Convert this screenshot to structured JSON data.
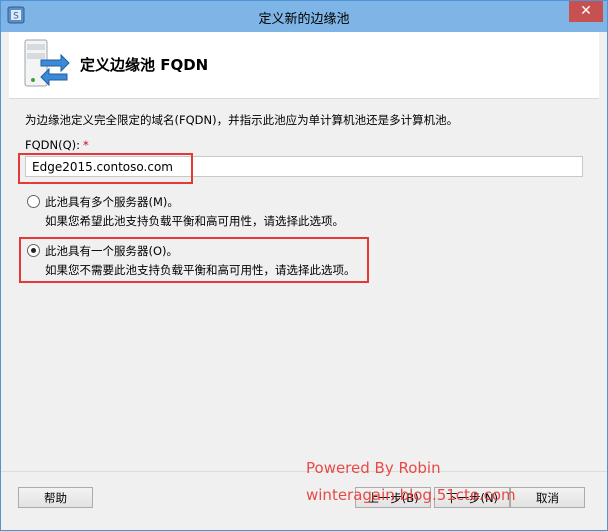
{
  "window": {
    "title": "定义新的边缘池",
    "close_glyph": "✕"
  },
  "header": {
    "title": "定义边缘池 FQDN"
  },
  "form": {
    "description": "为边缘池定义完全限定的域名(FQDN)，并指示此池应为单计算机池还是多计算机池。",
    "fqdn_label": "FQDN(Q):",
    "required_mark": "*",
    "fqdn_value": "Edge2015.contoso.com",
    "options": [
      {
        "label": "此池具有多个服务器(M)。",
        "sub": "如果您希望此池支持负载平衡和高可用性，请选择此选项。",
        "selected": false
      },
      {
        "label": "此池具有一个服务器(O)。",
        "sub": "如果您不需要此池支持负载平衡和高可用性，请选择此选项。",
        "selected": true
      }
    ]
  },
  "footer": {
    "help_label": "帮助",
    "back_label": "上一步(B)",
    "next_label": "下一步(N)",
    "cancel_label": "取消"
  },
  "watermark": {
    "line1": "Powered By Robin",
    "line2": "winteragain.blog.51cto.com"
  },
  "colors": {
    "titlebar": "#7fb5e6",
    "highlight": "#e53935",
    "close_button": "#c75050"
  }
}
